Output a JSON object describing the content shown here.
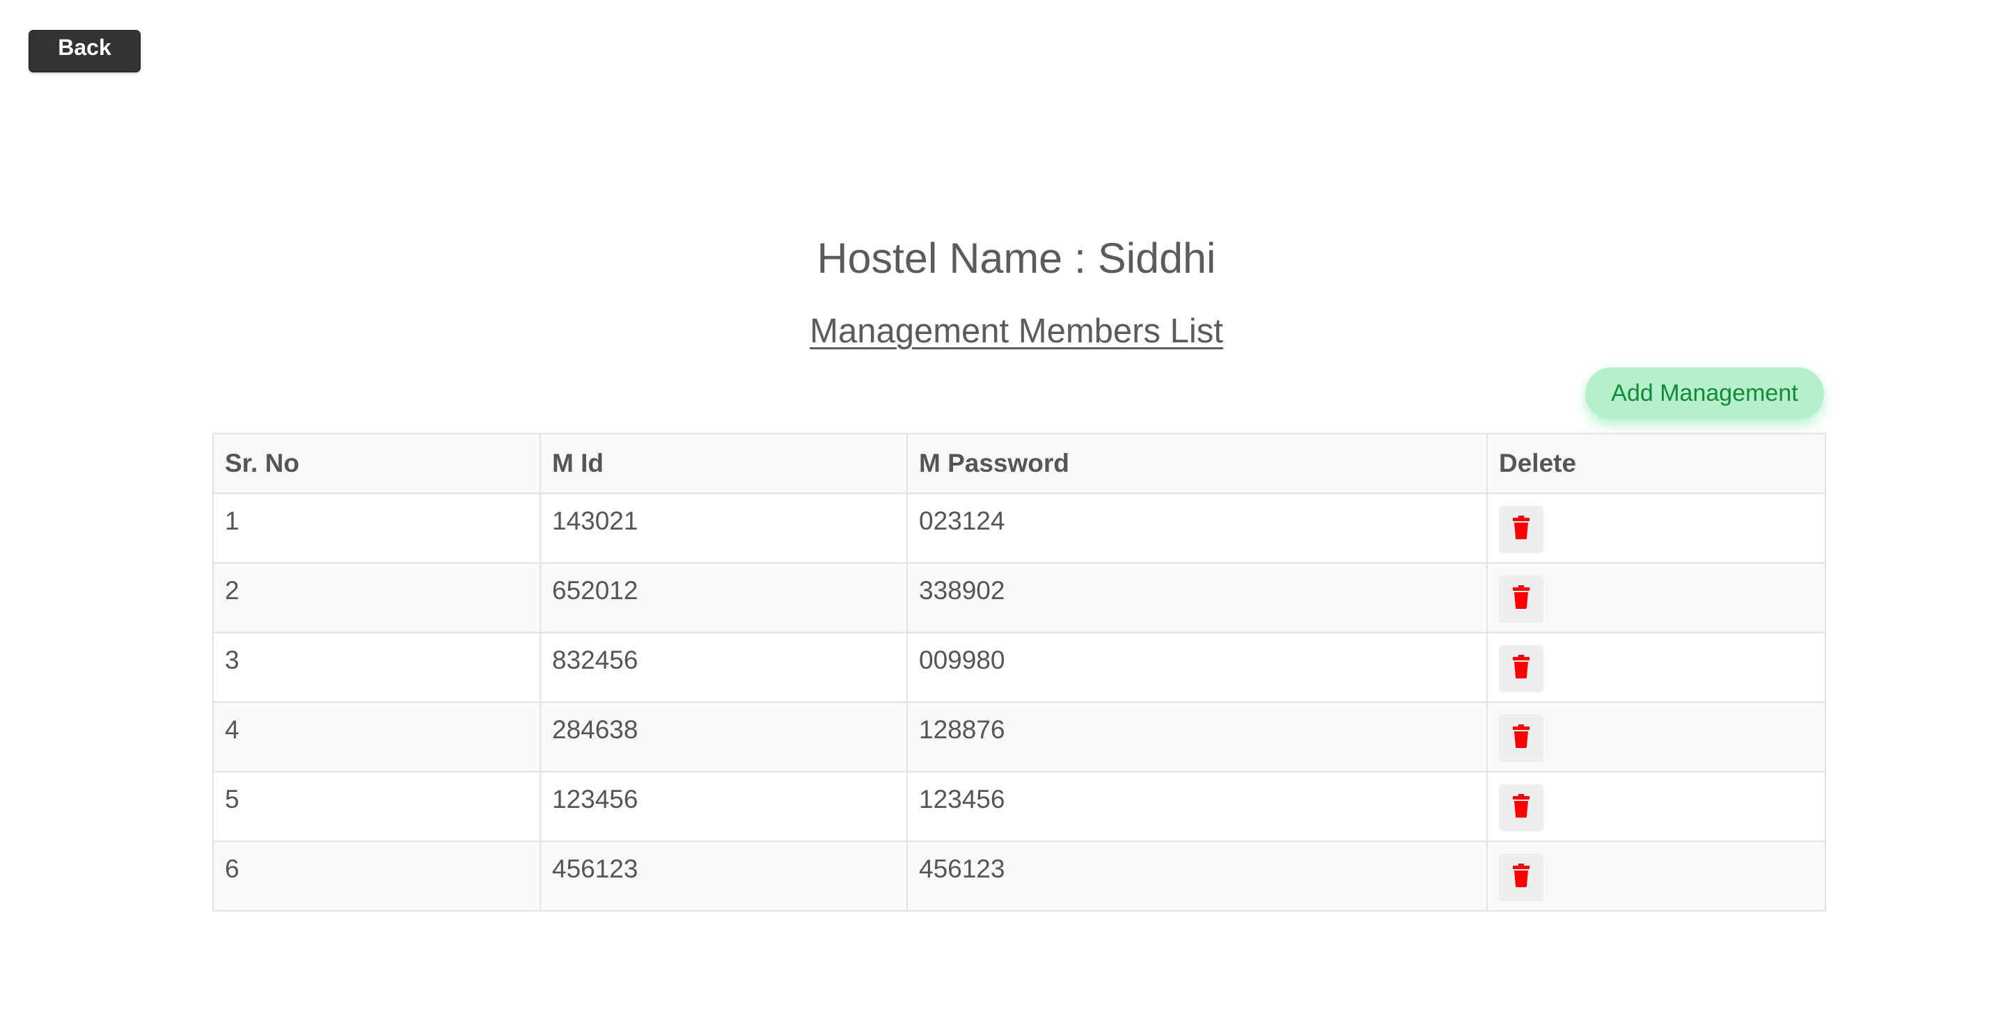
{
  "back_button": {
    "label": "Back"
  },
  "title": "Hostel Name : Siddhi",
  "subtitle": "Management Members List",
  "add_button": {
    "label": "Add Management"
  },
  "table": {
    "headers": [
      "Sr. No",
      "M Id",
      "M Password",
      "Delete"
    ],
    "rows": [
      {
        "sr": "1",
        "mid": "143021",
        "mpass": "023124"
      },
      {
        "sr": "2",
        "mid": "652012",
        "mpass": "338902"
      },
      {
        "sr": "3",
        "mid": "832456",
        "mpass": "009980"
      },
      {
        "sr": "4",
        "mid": "284638",
        "mpass": "128876"
      },
      {
        "sr": "5",
        "mid": "123456",
        "mpass": "123456"
      },
      {
        "sr": "6",
        "mid": "456123",
        "mpass": "456123"
      }
    ],
    "delete_icon": "trash-icon",
    "delete_icon_color": "#ff0000"
  },
  "colors": {
    "back_button_bg": "#333333",
    "add_button_bg": "#b4f0cc",
    "add_button_text": "#138a36",
    "text": "#555555"
  }
}
